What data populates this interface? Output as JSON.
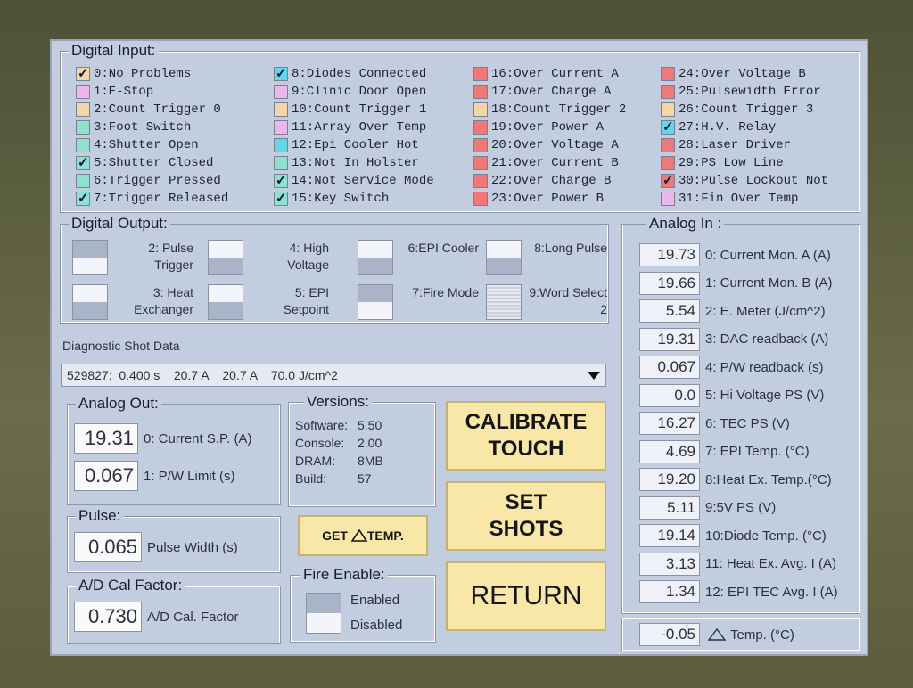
{
  "digital_input": {
    "title": "Digital Input:",
    "columns": [
      [
        {
          "label": "0:No Problems",
          "color": "#f4d6a6",
          "checked": true
        },
        {
          "label": "1:E-Stop",
          "color": "#eab8ee",
          "checked": false
        },
        {
          "label": "2:Count Trigger 0",
          "color": "#f4d6a6",
          "checked": false
        },
        {
          "label": "3:Foot Switch",
          "color": "#8ee0d0",
          "checked": false
        },
        {
          "label": "4:Shutter Open",
          "color": "#8ee0d0",
          "checked": false
        },
        {
          "label": "5:Shutter Closed",
          "color": "#8ee0d0",
          "checked": true
        },
        {
          "label": "6:Trigger Pressed",
          "color": "#8ee0d0",
          "checked": false
        },
        {
          "label": "7:Trigger Released",
          "color": "#8ee0d0",
          "checked": true
        }
      ],
      [
        {
          "label": "8:Diodes Connected",
          "color": "#5fd8e8",
          "checked": true
        },
        {
          "label": "9:Clinic Door Open",
          "color": "#eab8ee",
          "checked": false
        },
        {
          "label": "10:Count Trigger 1",
          "color": "#f4d6a6",
          "checked": false
        },
        {
          "label": "11:Array Over Temp",
          "color": "#eab8ee",
          "checked": false
        },
        {
          "label": "12:Epi Cooler Hot",
          "color": "#5fd8e8",
          "checked": false
        },
        {
          "label": "13:Not In Holster",
          "color": "#8ee0d0",
          "checked": false
        },
        {
          "label": "14:Not Service Mode",
          "color": "#8ee0d0",
          "checked": true
        },
        {
          "label": "15:Key Switch",
          "color": "#8ee0d0",
          "checked": true
        }
      ],
      [
        {
          "label": "16:Over Current A",
          "color": "#f07878",
          "checked": false
        },
        {
          "label": "17:Over Charge A",
          "color": "#f07878",
          "checked": false
        },
        {
          "label": "18:Count Trigger 2",
          "color": "#f4d6a6",
          "checked": false
        },
        {
          "label": "19:Over Power A",
          "color": "#f07878",
          "checked": false
        },
        {
          "label": "20:Over Voltage A",
          "color": "#f07878",
          "checked": false
        },
        {
          "label": "21:Over Current B",
          "color": "#f07878",
          "checked": false
        },
        {
          "label": "22:Over Charge B",
          "color": "#f07878",
          "checked": false
        },
        {
          "label": "23:Over Power B",
          "color": "#f07878",
          "checked": false
        }
      ],
      [
        {
          "label": "24:Over Voltage B",
          "color": "#f07878",
          "checked": false
        },
        {
          "label": "25:Pulsewidth Error",
          "color": "#f07878",
          "checked": false
        },
        {
          "label": "26:Count Trigger 3",
          "color": "#f4d6a6",
          "checked": false
        },
        {
          "label": "27:H.V. Relay",
          "color": "#5fd8e8",
          "checked": true
        },
        {
          "label": "28:Laser Driver",
          "color": "#f07878",
          "checked": false
        },
        {
          "label": "29:PS Low Line",
          "color": "#f07878",
          "checked": false
        },
        {
          "label": "30:Pulse Lockout Not",
          "color": "#f07878",
          "checked": true
        },
        {
          "label": "31:Fin Over Temp",
          "color": "#eab8ee",
          "checked": false
        }
      ]
    ]
  },
  "digital_output": {
    "title": "Digital Output:",
    "items": [
      {
        "label": "2: Pulse Trigger",
        "state": "bottom"
      },
      {
        "label": "4: High Voltage",
        "state": "top"
      },
      {
        "label": "6:EPI Cooler",
        "state": "top"
      },
      {
        "label": "8:Long Pulse",
        "state": "top"
      },
      {
        "label": "3: Heat Exchanger",
        "state": "top"
      },
      {
        "label": "5: EPI Setpoint",
        "state": "top"
      },
      {
        "label": "7:Fire Mode",
        "state": "bottom"
      },
      {
        "label": "9:Word Select 2",
        "state": "striped"
      }
    ]
  },
  "diagnostic": {
    "label": "Diagnostic Shot Data",
    "selected": "529827:  0.400 s    20.7 A    20.7 A    70.0 J/cm^2"
  },
  "analog_out": {
    "title": "Analog Out:",
    "rows": [
      {
        "value": "19.31",
        "label": "0: Current S.P. (A)"
      },
      {
        "value": "0.067",
        "label": "1: P/W Limit (s)"
      }
    ]
  },
  "pulse": {
    "title": "Pulse:",
    "value": "0.065",
    "label": "Pulse Width (s)"
  },
  "ad_cal": {
    "title": "A/D Cal Factor:",
    "value": "0.730",
    "label": "A/D Cal. Factor"
  },
  "versions": {
    "title": "Versions:",
    "rows": [
      {
        "k": "Software:",
        "v": "5.50"
      },
      {
        "k": "Console:",
        "v": "2.00"
      },
      {
        "k": "DRAM:",
        "v": "8MB"
      },
      {
        "k": "Build:",
        "v": "57"
      }
    ]
  },
  "get_temp": {
    "label_a": "GET ",
    "label_b": "TEMP."
  },
  "fire_enable": {
    "title": "Fire Enable:",
    "enabled": "Enabled",
    "disabled": "Disabled"
  },
  "buttons": {
    "calibrate": "CALIBRATE TOUCH",
    "set_shots": "SET SHOTS",
    "return": "RETURN"
  },
  "analog_in": {
    "title": "Analog In :",
    "rows": [
      {
        "value": "19.73",
        "label": "0: Current Mon. A (A)"
      },
      {
        "value": "19.66",
        "label": "1: Current Mon. B (A)"
      },
      {
        "value": "5.54",
        "label": "2: E. Meter (J/cm^2)"
      },
      {
        "value": "19.31",
        "label": "3: DAC readback (A)"
      },
      {
        "value": "0.067",
        "label": "4: P/W readback (s)"
      },
      {
        "value": "0.0",
        "label": "5: Hi Voltage PS (V)"
      },
      {
        "value": "16.27",
        "label": "6: TEC PS (V)"
      },
      {
        "value": "4.69",
        "label": "7: EPI Temp. (°C)"
      },
      {
        "value": "19.20",
        "label": "8:Heat Ex. Temp.(°C)"
      },
      {
        "value": "5.11",
        "label": "9:5V PS (V)"
      },
      {
        "value": "19.14",
        "label": "10:Diode Temp. (°C)"
      },
      {
        "value": "3.13",
        "label": "11: Heat Ex. Avg. I (A)"
      },
      {
        "value": "1.34",
        "label": "12: EPI TEC Avg. I (A)"
      }
    ],
    "delta_value": "-0.05",
    "delta_label": "Temp. (°C)"
  }
}
